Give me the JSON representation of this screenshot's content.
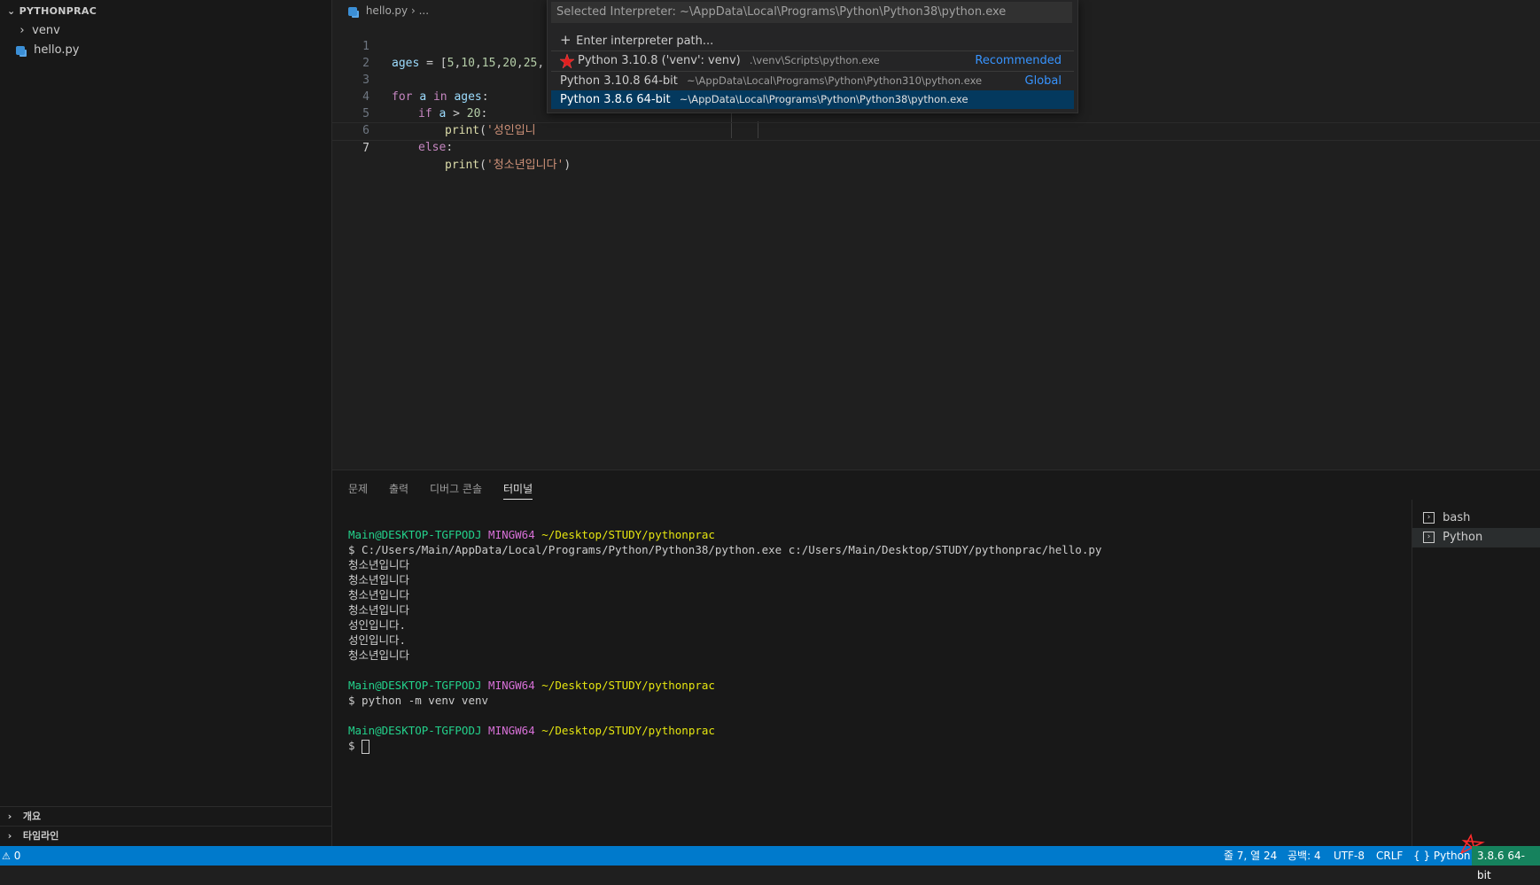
{
  "sidebar": {
    "header": "PYTHONPRAC",
    "items": [
      {
        "label": "venv",
        "type": "folder"
      },
      {
        "label": "hello.py",
        "type": "file"
      }
    ],
    "sections": [
      "개요",
      "타임라인"
    ]
  },
  "editor": {
    "breadcrumb_file": "hello.py",
    "breadcrumb_more": "...",
    "lines": [
      {
        "n": "1",
        "text": "ages = [5,10,15,20,25,"
      },
      {
        "n": "2",
        "text": ""
      },
      {
        "n": "3",
        "text": "for a in ages:"
      },
      {
        "n": "4",
        "text": "if a > 20:"
      },
      {
        "n": "5",
        "text": "print('성인입니"
      },
      {
        "n": "6",
        "text": "else:"
      },
      {
        "n": "7",
        "text": "print('청소년입니다')"
      }
    ]
  },
  "quickpick": {
    "placeholder": "Selected Interpreter: ~\\AppData\\Local\\Programs\\Python\\Python38\\python.exe",
    "enter_path": "Enter interpreter path...",
    "options": [
      {
        "label": "Python 3.10.8 ('venv': venv)",
        "desc": ".\\venv\\Scripts\\python.exe",
        "tag": "Recommended"
      },
      {
        "label": "Python 3.10.8 64-bit",
        "desc": "~\\AppData\\Local\\Programs\\Python\\Python310\\python.exe",
        "tag": "Global"
      },
      {
        "label": "Python 3.8.6 64-bit",
        "desc": "~\\AppData\\Local\\Programs\\Python\\Python38\\python.exe",
        "tag": ""
      }
    ]
  },
  "panel": {
    "tabs": [
      "문제",
      "출력",
      "디버그 콘솔",
      "터미널"
    ],
    "prompt_user": "Main@DESKTOP-TGFPODJ",
    "prompt_host": "MINGW64",
    "prompt_path": "~/Desktop/STUDY/pythonprac",
    "cmd1": "$ C:/Users/Main/AppData/Local/Programs/Python/Python38/python.exe c:/Users/Main/Desktop/STUDY/pythonprac/hello.py",
    "outputs": [
      "청소년입니다",
      "청소년입니다",
      "청소년입니다",
      "청소년입니다",
      "성인입니다.",
      "성인입니다.",
      "청소년입니다"
    ],
    "cmd2": "$ python -m venv venv",
    "prompt_symbol": "$",
    "terminals": [
      "bash",
      "Python"
    ]
  },
  "statusbar": {
    "problems": "0",
    "position": "줄 7, 열 24",
    "spaces": "공백: 4",
    "encoding": "UTF-8",
    "eol": "CRLF",
    "language": "Python",
    "interpreter": "3.8.6 64-bit"
  }
}
